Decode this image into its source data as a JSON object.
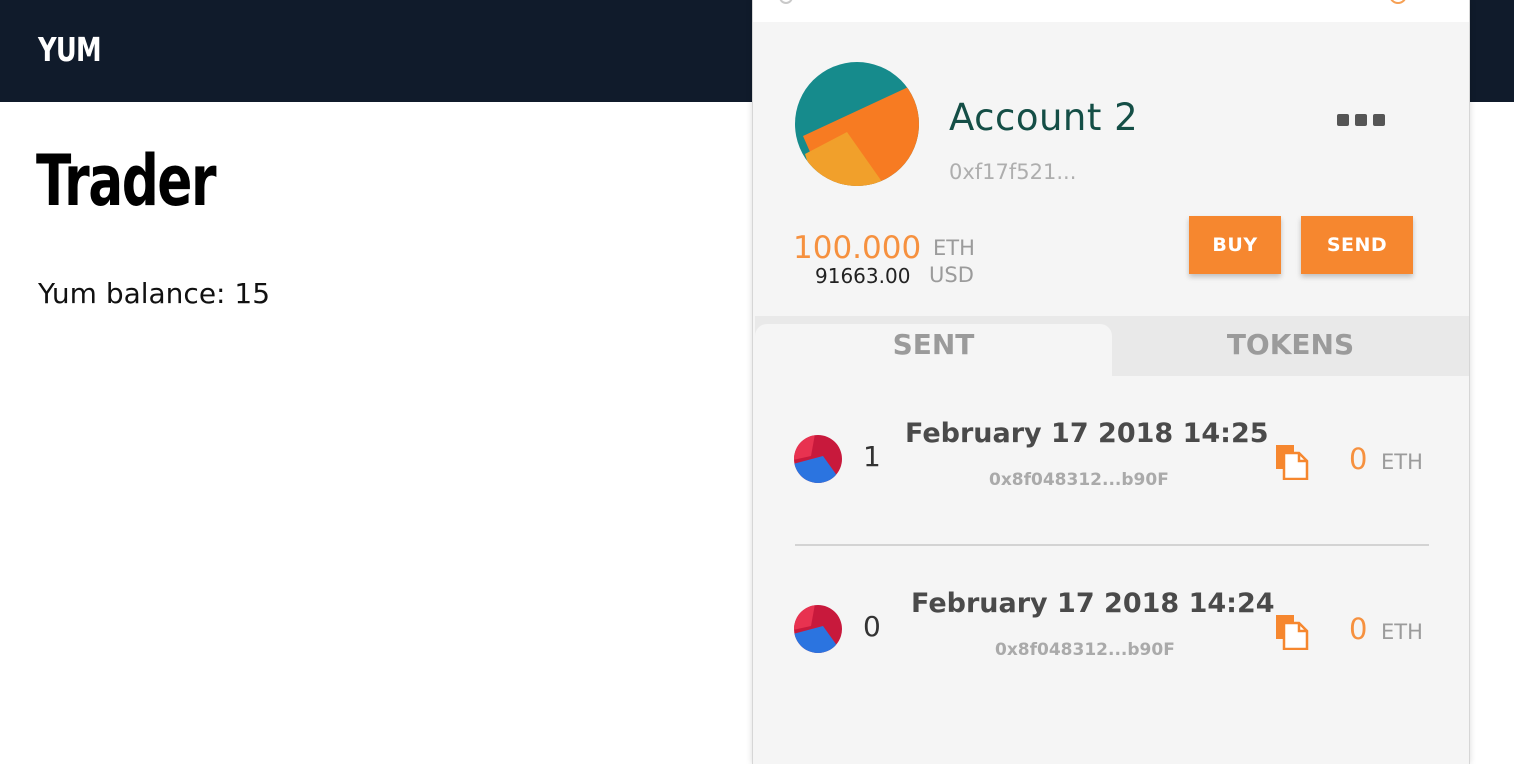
{
  "app": {
    "brand": "YUM",
    "page_title": "Trader",
    "balance_text": "Yum balance: 15"
  },
  "wallet": {
    "account_name": "Account 2",
    "address_short": "0xf17f521...",
    "eth_balance": "100.000",
    "eth_unit": "ETH",
    "usd_balance": "91663.00",
    "usd_unit": "USD",
    "buy_label": "BUY",
    "send_label": "SEND",
    "more_icon": "ellipsis-icon",
    "tabs": [
      {
        "label": "SENT",
        "active": true
      },
      {
        "label": "TOKENS",
        "active": false
      }
    ],
    "transactions": [
      {
        "nonce": "1",
        "date": "February 17 2018 14:25",
        "hash": "0x8f048312...b90F",
        "value": "0",
        "unit": "ETH",
        "copy_icon": "copy-icon"
      },
      {
        "nonce": "0",
        "date": "February 17 2018 14:24",
        "hash": "0x8f048312...b90F",
        "value": "0",
        "unit": "ETH",
        "copy_icon": "copy-icon"
      }
    ]
  },
  "colors": {
    "topbar": "#101b2b",
    "accent_orange": "#f6872f",
    "account_name": "#144e46",
    "muted_text": "#9b9b9b"
  }
}
